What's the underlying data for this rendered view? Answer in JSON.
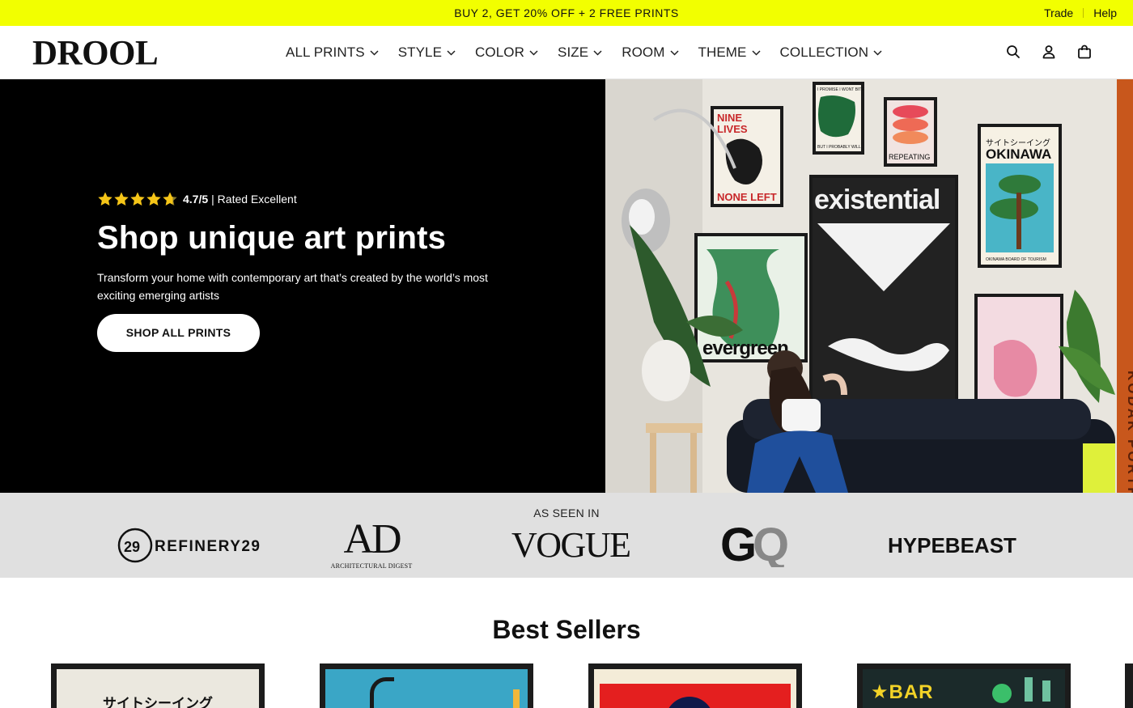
{
  "announcement": {
    "text": "BUY 2, GET 20% OFF + 2 FREE PRINTS",
    "links": [
      "Trade",
      "Help"
    ]
  },
  "header": {
    "logo": "DROOL",
    "nav": [
      {
        "label": "ALL PRINTS"
      },
      {
        "label": "STYLE"
      },
      {
        "label": "COLOR"
      },
      {
        "label": "SIZE"
      },
      {
        "label": "ROOM"
      },
      {
        "label": "THEME"
      },
      {
        "label": "COLLECTION"
      }
    ],
    "icons": [
      "search-icon",
      "account-icon",
      "cart-icon"
    ]
  },
  "hero": {
    "rating_score": "4.7/5",
    "rating_text": "| Rated Excellent",
    "stars": 4.7,
    "title": "Shop unique art prints",
    "subtitle": "Transform your home with contemporary art that’s created by the world’s most exciting emerging artists",
    "cta": "SHOP ALL PRINTS",
    "image": {
      "poster_nine_lives": [
        "NINE",
        "LIVES",
        "NONE LEFT"
      ],
      "poster_promise": [
        "I PROMISE I WONT BITE",
        "BUT I PROBABLY WILL"
      ],
      "poster_repeating": "REPEATING",
      "poster_okinawa_jp": "サイトシーイング",
      "poster_okinawa": "OKINAWA",
      "poster_okinawa_small": "OKINAWA BOARD OF TOURISM",
      "poster_existential": "existential",
      "poster_evergreen": "evergreen",
      "edge_text": "KODAK PORTR"
    }
  },
  "press": {
    "label": "AS SEEN IN",
    "logos": [
      "REFINERY29",
      "AD",
      "ARCHITECTURAL DIGEST",
      "VOGUE",
      "GQ",
      "HYPEBEAST"
    ]
  },
  "best_sellers": {
    "title": "Best Sellers",
    "products": [
      {
        "preview_text": "サイトシーイング"
      },
      {
        "preview_text": ""
      },
      {
        "preview_text": ""
      },
      {
        "preview_text": "★BAR"
      }
    ]
  },
  "colors": {
    "announcement_bg": "#f2ff00",
    "hero_bg": "#000000",
    "press_bg": "#e0e0e0"
  }
}
